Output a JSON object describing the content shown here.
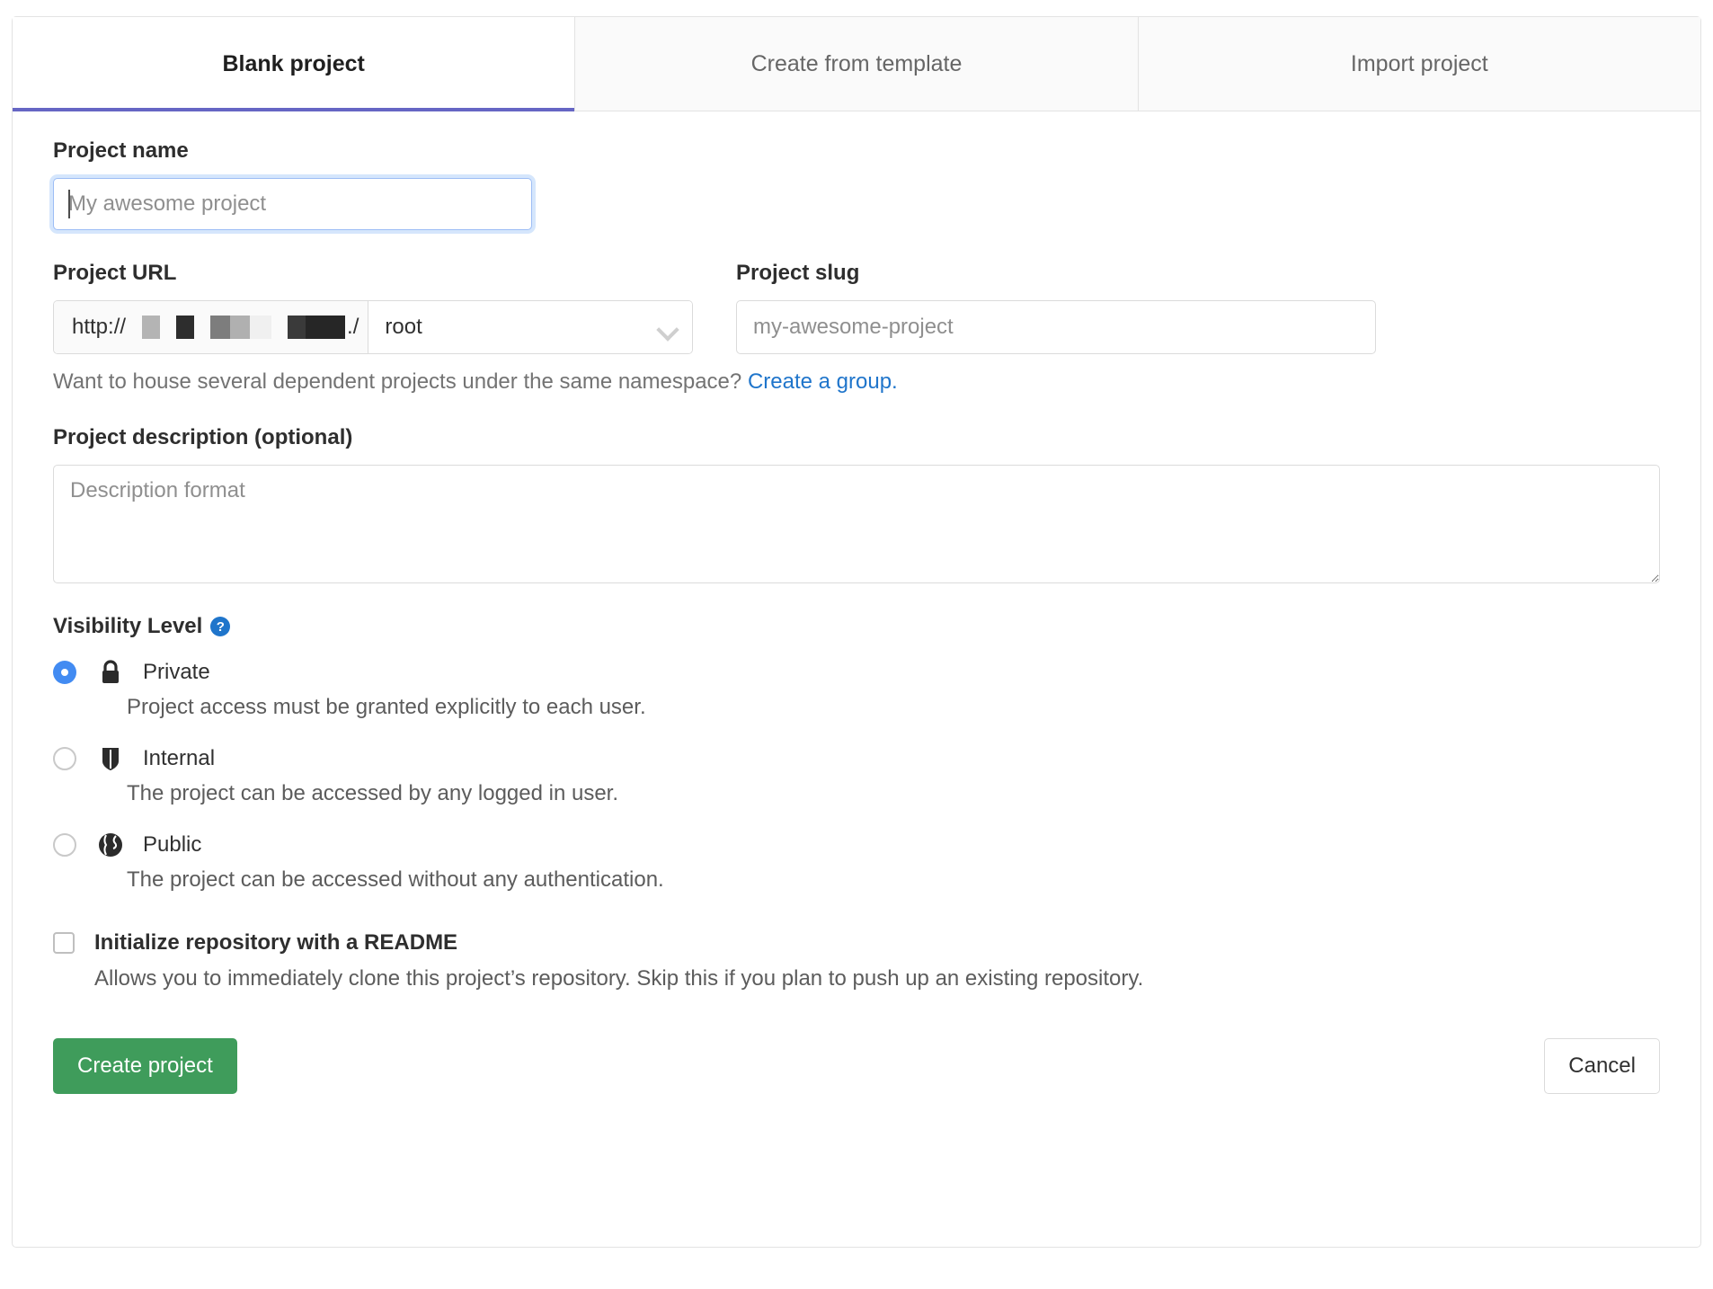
{
  "tabs": [
    {
      "label": "Blank project",
      "active": true
    },
    {
      "label": "Create from template",
      "active": false
    },
    {
      "label": "Import project",
      "active": false
    }
  ],
  "project_name": {
    "label": "Project name",
    "placeholder": "My awesome project",
    "value": "",
    "focused": true
  },
  "project_url": {
    "label": "Project URL",
    "scheme": "http://",
    "host_redacted": true,
    "separator": "./",
    "namespace": "root"
  },
  "project_slug": {
    "label": "Project slug",
    "placeholder": "my-awesome-project",
    "value": ""
  },
  "namespace_helper": {
    "text": "Want to house several dependent projects under the same namespace?",
    "link": "Create a group."
  },
  "project_description": {
    "label": "Project description (optional)",
    "placeholder": "Description format",
    "value": ""
  },
  "visibility": {
    "title": "Visibility Level",
    "help_icon": "question-mark-icon",
    "options": [
      {
        "name": "Private",
        "icon": "lock-icon",
        "description": "Project access must be granted explicitly to each user.",
        "selected": true
      },
      {
        "name": "Internal",
        "icon": "shield-icon",
        "description": "The project can be accessed by any logged in user.",
        "selected": false
      },
      {
        "name": "Public",
        "icon": "globe-icon",
        "description": "The project can be accessed without any authentication.",
        "selected": false
      }
    ]
  },
  "readme": {
    "label": "Initialize repository with a README",
    "description": "Allows you to immediately clone this project’s repository. Skip this if you plan to push up an existing repository.",
    "checked": false
  },
  "actions": {
    "primary": "Create project",
    "secondary": "Cancel"
  },
  "colors": {
    "accent_tab": "#6666c4",
    "link": "#1f75cb",
    "primary_button": "#3f9c5b",
    "radio_selected": "#428bf2",
    "focus_ring": "#9dbdf5"
  }
}
